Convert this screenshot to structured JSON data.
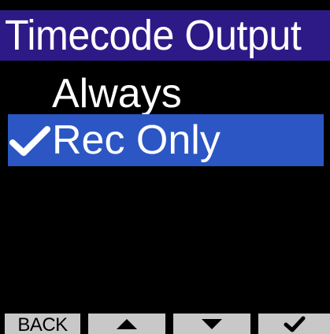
{
  "header": {
    "title": "Timecode Output"
  },
  "menu": {
    "items": [
      {
        "label": "Always",
        "selected": false
      },
      {
        "label": "Rec Only",
        "selected": true
      }
    ],
    "selected_check_icon": "checkmark-icon"
  },
  "softkeys": {
    "back_label": "BACK",
    "up_icon": "triangle-up-icon",
    "down_icon": "triangle-down-icon",
    "enter_icon": "checkmark-icon"
  },
  "colors": {
    "title_background": "#2e1a86",
    "selection_background": "#2b56c4",
    "softkey_background": "#c8c8c8",
    "screen_background": "#000000",
    "text": "#ffffff"
  }
}
